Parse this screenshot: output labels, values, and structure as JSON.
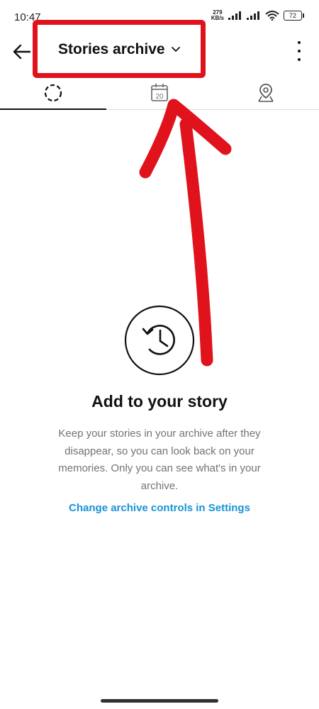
{
  "status_bar": {
    "time": "10:47",
    "net_speed_value": "279",
    "net_speed_unit": "KB/s",
    "battery": "72"
  },
  "header": {
    "title": "Stories archive"
  },
  "tabs": [
    {
      "name": "stories",
      "icon": "dashed-circle-icon",
      "active": true
    },
    {
      "name": "calendar",
      "icon": "calendar-icon",
      "label": "20",
      "active": false
    },
    {
      "name": "map",
      "icon": "map-pin-icon",
      "active": false
    }
  ],
  "empty_state": {
    "icon": "history-clock-icon",
    "title": "Add to your story",
    "body": "Keep your stories in your archive after they disappear, so you can look back on your memories. Only you can see what's in your archive.",
    "link": "Change archive controls in Settings"
  },
  "colors": {
    "annotation": "#e0131d",
    "link": "#1a93d6",
    "body_text": "#737373"
  }
}
